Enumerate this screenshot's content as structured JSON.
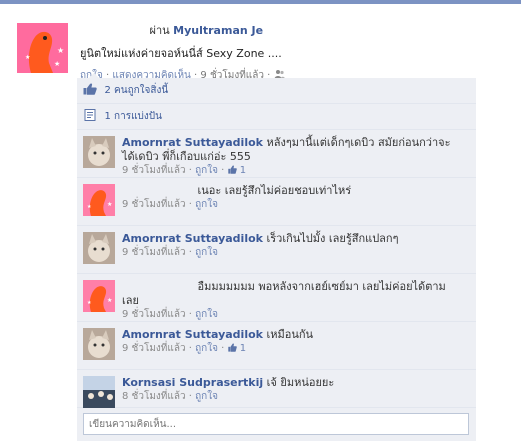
{
  "post": {
    "via_prefix": "ผ่าน",
    "via_name": "Myultraman Je",
    "text": "ยูนิตใหม่แห่งค่ายจอห์นนี่ส์ Sexy Zone ....",
    "meta": {
      "like": "ถูกใจ",
      "comment": "แสดงความคิดเห็น",
      "time": "9 ชั่วโมงที่แล้ว"
    }
  },
  "feedback": {
    "likes_text": "2 คนถูกใจสิ่งนี้",
    "shares_text": "1 การแบ่งปัน"
  },
  "comments": [
    {
      "author": "Amornrat Suttayadilok",
      "text_line1": "หลังๆมานี้แต่เด็กๆเดบิว สมัยก่อนกว่าจะ",
      "text_line2": "ได้เดบิว พี่ก็เกือบแก่อ่ะ 555",
      "time": "9 ชั่วโมงที่แล้ว",
      "like": "ถูกใจ",
      "likes_count": "1"
    },
    {
      "author": "",
      "text": "เนอะ เลยรู้สึกไม่ค่อยชอบเท่าไหร่",
      "time": "9 ชั่วโมงที่แล้ว",
      "like": "ถูกใจ"
    },
    {
      "author": "Amornrat Suttayadilok",
      "text": "เร็วเกินไปมั้ง เลยรู้สึกแปลกๆ",
      "time": "9 ชั่วโมงที่แล้ว",
      "like": "ถูกใจ"
    },
    {
      "author": "",
      "text": "อืมมมมมมม พอหลังจากเฮย์เซย์มา เลยไม่ค่อยได้ตามเลย",
      "time": "9 ชั่วโมงที่แล้ว",
      "like": "ถูกใจ"
    },
    {
      "author": "Amornrat Suttayadilok",
      "text": "เหมือนกัน",
      "time": "9 ชั่วโมงที่แล้ว",
      "like": "ถูกใจ",
      "likes_count": "1"
    },
    {
      "author": "Kornsasi Sudprasertkij",
      "text": "เจ้ ยิมหน่อยยะ",
      "time": "8 ชั่วโมงที่แล้ว",
      "like": "ถูกใจ"
    }
  ],
  "write_comment": {
    "placeholder": "เขียนความคิดเห็น..."
  },
  "colors": {
    "link": "#3b5998",
    "panel": "#edeff4",
    "avatar_pink": "#ff6b9e"
  }
}
